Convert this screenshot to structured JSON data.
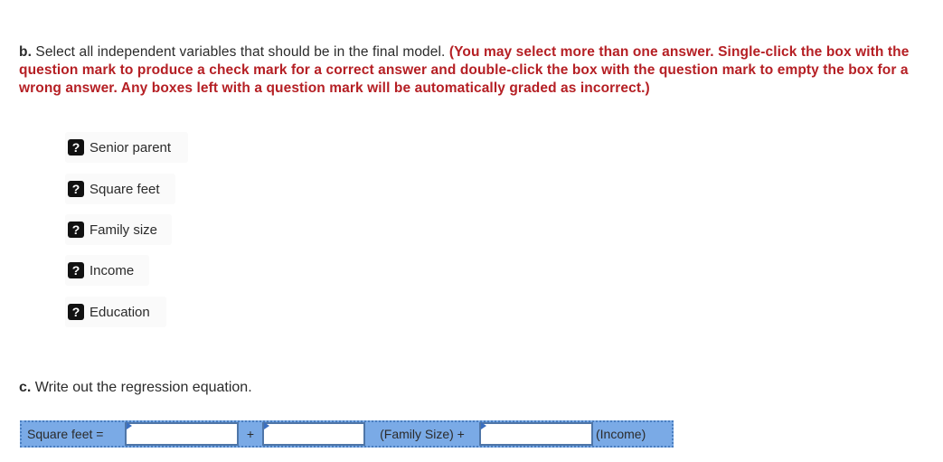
{
  "question_b": {
    "letter": "b.",
    "text": " Select all independent variables that should be in the final model. ",
    "instructions": "(You may select more than one answer. Single-click the box with the question mark to produce a check mark for a correct answer and double-click the box with the question mark to empty the box for a wrong answer. Any boxes left with a question mark will be automatically graded as incorrect.)",
    "choices": [
      {
        "label": "Senior parent",
        "state": "?"
      },
      {
        "label": "Square feet",
        "state": "?"
      },
      {
        "label": "Family size",
        "state": "?"
      },
      {
        "label": "Income",
        "state": "?"
      },
      {
        "label": "Education",
        "state": "?"
      }
    ]
  },
  "question_c": {
    "letter": "c.",
    "text": " Write out the regression equation."
  },
  "equation": {
    "lhs": "Square feet =",
    "input1": "",
    "op1": "+",
    "input2": "",
    "term2": "(Family Size) +",
    "input3": "",
    "term3": "(Income)"
  },
  "colors": {
    "instruction_red": "#b51f24",
    "equation_blue": "#7aaae6",
    "equation_border": "#4f76a8"
  }
}
